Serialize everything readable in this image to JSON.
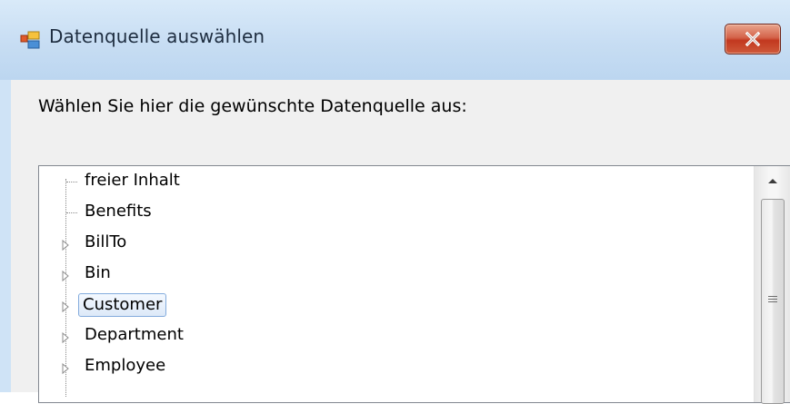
{
  "window": {
    "title": "Datenquelle auswählen",
    "close_icon": "close-icon"
  },
  "prompt": "Wählen Sie hier die gewünschte Datenquelle aus:",
  "tree": {
    "items": [
      {
        "label": "freier Inhalt",
        "expandable": false,
        "selected": false
      },
      {
        "label": "Benefits",
        "expandable": false,
        "selected": false
      },
      {
        "label": "BillTo",
        "expandable": true,
        "selected": false
      },
      {
        "label": "Bin",
        "expandable": true,
        "selected": false
      },
      {
        "label": "Customer",
        "expandable": true,
        "selected": true
      },
      {
        "label": "Department",
        "expandable": true,
        "selected": false
      },
      {
        "label": "Employee",
        "expandable": true,
        "selected": false
      }
    ]
  },
  "colors": {
    "titlebar": "#c7ddf3",
    "close_button": "#c2381f",
    "selection_border": "#84acdd"
  }
}
